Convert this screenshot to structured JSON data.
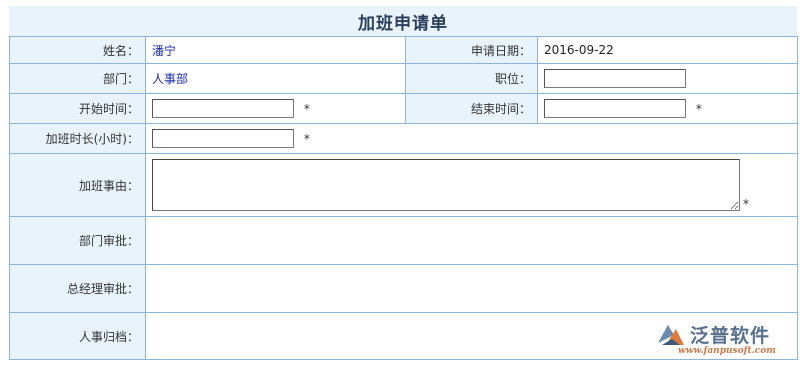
{
  "title": "加班申请单",
  "rows": {
    "name": {
      "label": "姓名：",
      "value": "潘宁"
    },
    "apply_date": {
      "label": "申请日期：",
      "value": "2016-09-22"
    },
    "department": {
      "label": "部门：",
      "value": "人事部"
    },
    "position": {
      "label": "职位：",
      "value": ""
    },
    "start_time": {
      "label": "开始时间：",
      "value": "",
      "required": "*"
    },
    "end_time": {
      "label": "结束时间：",
      "value": "",
      "required": "*"
    },
    "duration": {
      "label": "加班时长(小时)：",
      "value": "",
      "required": "*"
    },
    "reason": {
      "label": "加班事由：",
      "value": "",
      "required": "*"
    },
    "dept_approval": {
      "label": "部门审批："
    },
    "gm_approval": {
      "label": "总经理审批："
    },
    "hr_archive": {
      "label": "人事归档："
    }
  },
  "watermark": {
    "brand": "泛普软件",
    "url": "www.fanpusoft.com"
  },
  "colors": {
    "label_bg": "#e8f3fb",
    "border": "#8fb4d4",
    "link_text": "#1a2ea8"
  }
}
